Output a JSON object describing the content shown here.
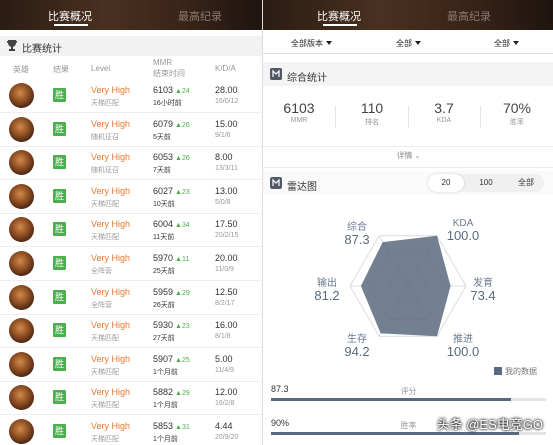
{
  "left": {
    "tabs": [
      {
        "label": "比赛概况",
        "active": true
      },
      {
        "label": "最高纪录",
        "active": false
      }
    ],
    "section_title": "比赛统计",
    "columns": {
      "hero": "英雄",
      "result": "结果",
      "level": "Level",
      "mmr": "MMR",
      "time": "结束时间",
      "kda": "K/D/A"
    },
    "matches": [
      {
        "result": "胜",
        "level": "Very High",
        "mode": "天梯匹配",
        "mmr": "6103",
        "delta": "▲24",
        "time": "16小时前",
        "kda": "28.00",
        "kda_detail": "16/0/12"
      },
      {
        "result": "胜",
        "level": "Very High",
        "mode": "随机征召",
        "mmr": "6079",
        "delta": "▲26",
        "time": "5天前",
        "kda": "15.00",
        "kda_detail": "9/1/6"
      },
      {
        "result": "胜",
        "level": "Very High",
        "mode": "随机征召",
        "mmr": "6053",
        "delta": "▲26",
        "time": "7天前",
        "kda": "8.00",
        "kda_detail": "13/3/11"
      },
      {
        "result": "胜",
        "level": "Very High",
        "mode": "天梯匹配",
        "mmr": "6027",
        "delta": "▲23",
        "time": "10天前",
        "kda": "13.00",
        "kda_detail": "5/0/8"
      },
      {
        "result": "胜",
        "level": "Very High",
        "mode": "天梯匹配",
        "mmr": "6004",
        "delta": "▲34",
        "time": "11天前",
        "kda": "17.50",
        "kda_detail": "20/2/15"
      },
      {
        "result": "胜",
        "level": "Very High",
        "mode": "全阵营",
        "mmr": "5970",
        "delta": "▲11",
        "time": "25天前",
        "kda": "20.00",
        "kda_detail": "11/0/9"
      },
      {
        "result": "胜",
        "level": "Very High",
        "mode": "全阵营",
        "mmr": "5959",
        "delta": "▲29",
        "time": "26天前",
        "kda": "12.50",
        "kda_detail": "8/2/17"
      },
      {
        "result": "胜",
        "level": "Very High",
        "mode": "天梯匹配",
        "mmr": "5930",
        "delta": "▲23",
        "time": "27天前",
        "kda": "16.00",
        "kda_detail": "8/1/8"
      },
      {
        "result": "胜",
        "level": "Very High",
        "mode": "天梯匹配",
        "mmr": "5907",
        "delta": "▲25",
        "time": "1个月前",
        "kda": "5.00",
        "kda_detail": "11/4/9"
      },
      {
        "result": "胜",
        "level": "Very High",
        "mode": "天梯匹配",
        "mmr": "5882",
        "delta": "▲29",
        "time": "1个月前",
        "kda": "12.00",
        "kda_detail": "16/2/8"
      },
      {
        "result": "胜",
        "level": "Very High",
        "mode": "天梯匹配",
        "mmr": "5853",
        "delta": "▲31",
        "time": "1个月前",
        "kda": "4.44",
        "kda_detail": "20/9/20"
      }
    ]
  },
  "right": {
    "tabs": [
      {
        "label": "比赛概况",
        "active": true
      },
      {
        "label": "最高纪录",
        "active": false
      }
    ],
    "filters": [
      "全部版本",
      "全部",
      "全部"
    ],
    "summary_title": "综合统计",
    "summary": [
      {
        "value": "6103",
        "label": "MMR"
      },
      {
        "value": "110",
        "label": "排名"
      },
      {
        "value": "3.7",
        "label": "KDA"
      },
      {
        "value": "70%",
        "label": "胜率"
      }
    ],
    "detail_label": "详情",
    "radar_title": "雷达图",
    "radar_pills": [
      "20",
      "100",
      "全部"
    ],
    "radar_active_pill": "20",
    "radar": {
      "axes": [
        {
          "label": "综合",
          "value": "87.3",
          "score": 87.3
        },
        {
          "label": "KDA",
          "value": "100.0",
          "score": 100.0
        },
        {
          "label": "发育",
          "value": "73.4",
          "score": 73.4
        },
        {
          "label": "推进",
          "value": "100.0",
          "score": 100.0
        },
        {
          "label": "生存",
          "value": "94.2",
          "score": 94.2
        },
        {
          "label": "输出",
          "value": "81.2",
          "score": 81.2
        }
      ],
      "max": 100
    },
    "legend": "我的数据",
    "bars": [
      {
        "value": "87.3",
        "label": "评分",
        "fraction": 0.873
      },
      {
        "value": "90%",
        "label": "胜率",
        "fraction": 0.9
      }
    ]
  },
  "watermark": "头条 @ES电竞GO",
  "colors": {
    "win": "#4cae4c",
    "level": "#e8792f",
    "delta": "#4cae4c",
    "radar_fill": "#5a6a7e"
  }
}
